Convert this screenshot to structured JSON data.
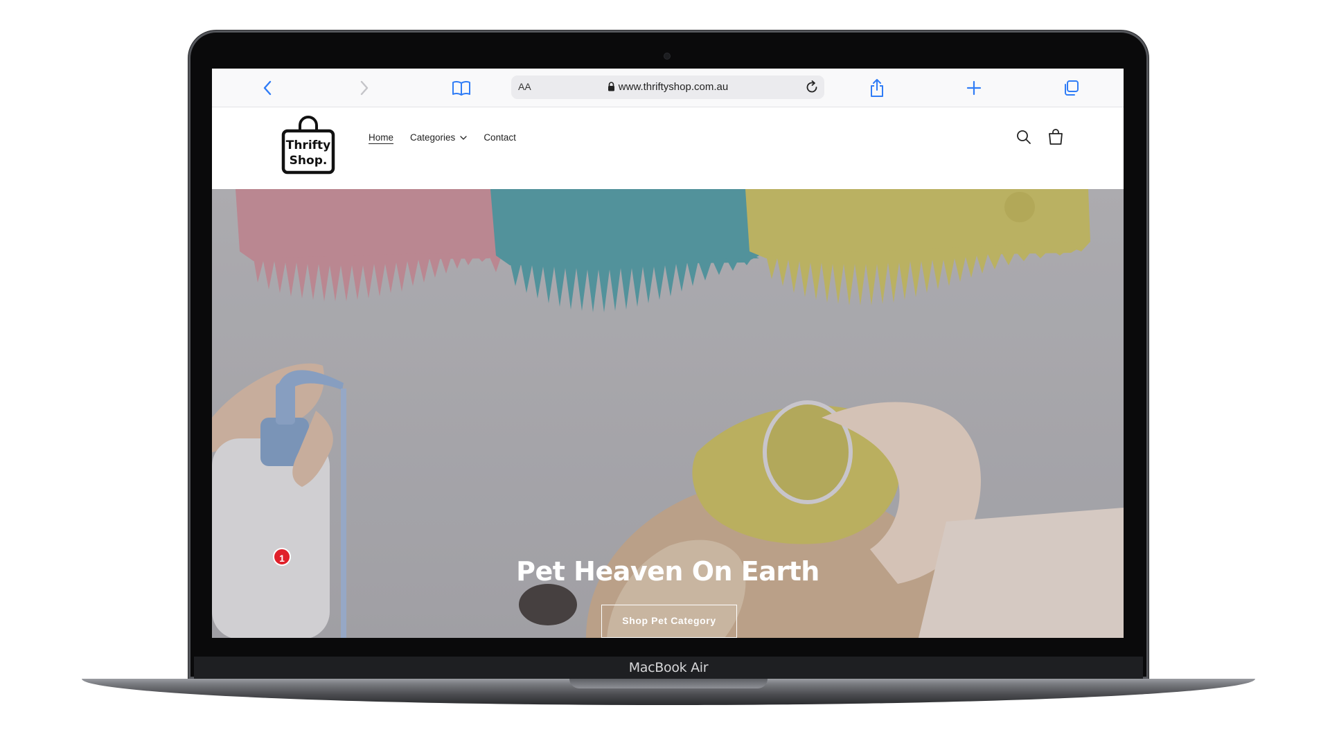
{
  "device": {
    "label": "MacBook Air"
  },
  "browser": {
    "url": "www.thriftyshop.com.au",
    "text_size_label": "AA",
    "icons": {
      "back": "chevron-left-icon",
      "forward": "chevron-right-icon",
      "bookmarks": "book-icon",
      "share": "share-icon",
      "new_tab": "plus-icon",
      "tabs": "tabs-icon",
      "reload": "reload-icon",
      "lock": "lock-icon"
    },
    "accent_color": "#2f7cf6"
  },
  "site": {
    "logo_text_line1": "Thrifty",
    "logo_text_line2": "Shop.",
    "nav": {
      "home": "Home",
      "categories": "Categories",
      "contact": "Contact"
    },
    "header_icons": {
      "search": "search-icon",
      "cart": "cart-icon"
    }
  },
  "hero": {
    "title": "Pet Heaven On Earth",
    "button_label": "Shop Pet Category",
    "colors": {
      "pink_brush": "#d9858f",
      "teal_brush": "#3aa3ae",
      "yellow_brush": "#d8c650"
    }
  },
  "widgets": {
    "gift": {
      "icon": "gift-icon",
      "badge_count": "1",
      "badge_color": "#e0202a"
    }
  }
}
